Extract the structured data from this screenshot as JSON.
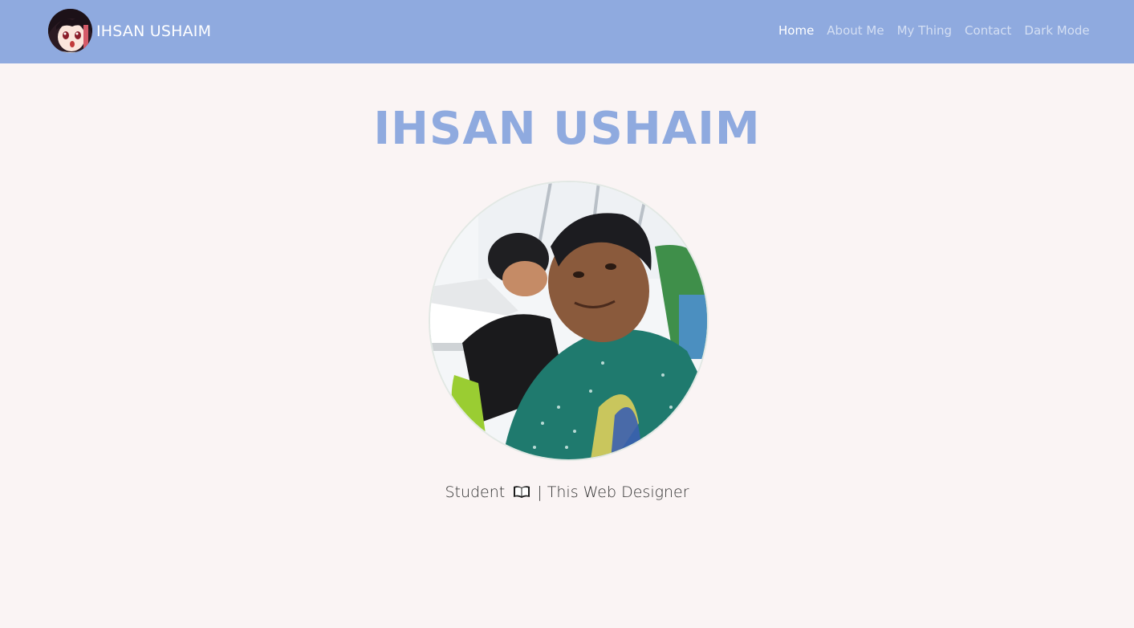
{
  "header": {
    "brand_name": "IHSAN USHAIM",
    "logo_icon": "anime-avatar-icon"
  },
  "nav": {
    "items": [
      {
        "label": "Home",
        "active": true
      },
      {
        "label": "About Me",
        "active": false
      },
      {
        "label": "My Thing",
        "active": false
      },
      {
        "label": "Contact",
        "active": false
      },
      {
        "label": "Dark Mode",
        "active": false
      }
    ]
  },
  "hero": {
    "title": "IHSAN USHAIM",
    "tagline_before": "Student",
    "tagline_icon": "open-book-icon",
    "tagline_after": "| This Web Designer"
  },
  "colors": {
    "navbar_bg": "#8faadf",
    "page_bg": "#faf4f4",
    "title": "#8faadf"
  }
}
